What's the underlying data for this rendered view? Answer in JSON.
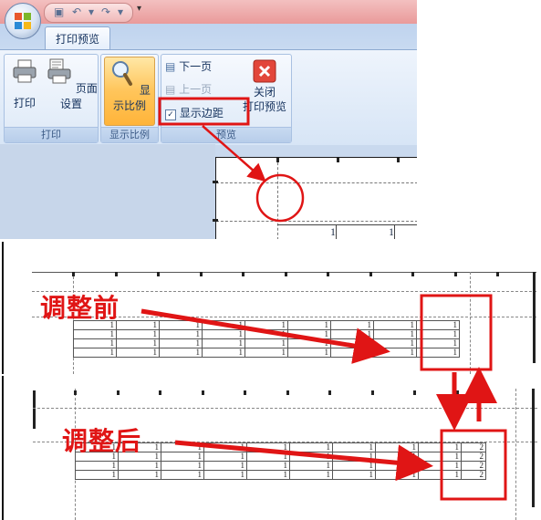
{
  "qat": {
    "save_icon": "save-icon",
    "undo_icon": "undo-icon",
    "redo_icon": "redo-icon",
    "dropdown": "▾"
  },
  "tab": {
    "label": "打印预览"
  },
  "ribbon": {
    "print_label": "打印",
    "page_setup_label": "页面设置",
    "zoom_label": "显示比例",
    "next_page_label": "下一页",
    "prev_page_label": "上一页",
    "show_margins_label": "显示边距",
    "show_margins_checked": true,
    "close_label_line1": "关闭",
    "close_label_line2": "打印预览",
    "group_print": "打印",
    "group_zoom": "显示比例",
    "group_preview": "预览"
  },
  "preview_cells": [
    "1",
    "1"
  ],
  "before": {
    "label": "调整前",
    "rows": [
      [
        "1",
        "1",
        "1",
        "1",
        "1",
        "1",
        "1",
        "1",
        "1"
      ],
      [
        "1",
        "1",
        "1",
        "1",
        "1",
        "1",
        "1",
        "1",
        "1"
      ],
      [
        "1",
        "1",
        "1",
        "1",
        "1",
        "1",
        "1",
        "1",
        "1"
      ],
      [
        "1",
        "1",
        "1",
        "1",
        "1",
        "1",
        "1",
        "1",
        "1"
      ]
    ]
  },
  "after": {
    "label": "调整后",
    "rows": [
      [
        "1",
        "1",
        "1",
        "1",
        "1",
        "1",
        "1",
        "1",
        "1",
        "2"
      ],
      [
        "1",
        "1",
        "1",
        "1",
        "1",
        "1",
        "1",
        "1",
        "1",
        "2"
      ],
      [
        "1",
        "1",
        "1",
        "1",
        "1",
        "1",
        "1",
        "1",
        "1",
        "2"
      ],
      [
        "1",
        "1",
        "1",
        "1",
        "1",
        "1",
        "1",
        "1",
        "1",
        "2"
      ]
    ]
  },
  "colors": {
    "annotation": "#e01515",
    "ribbon_bg": "#d7e5f6",
    "titlebar": "#ea9f9f"
  }
}
